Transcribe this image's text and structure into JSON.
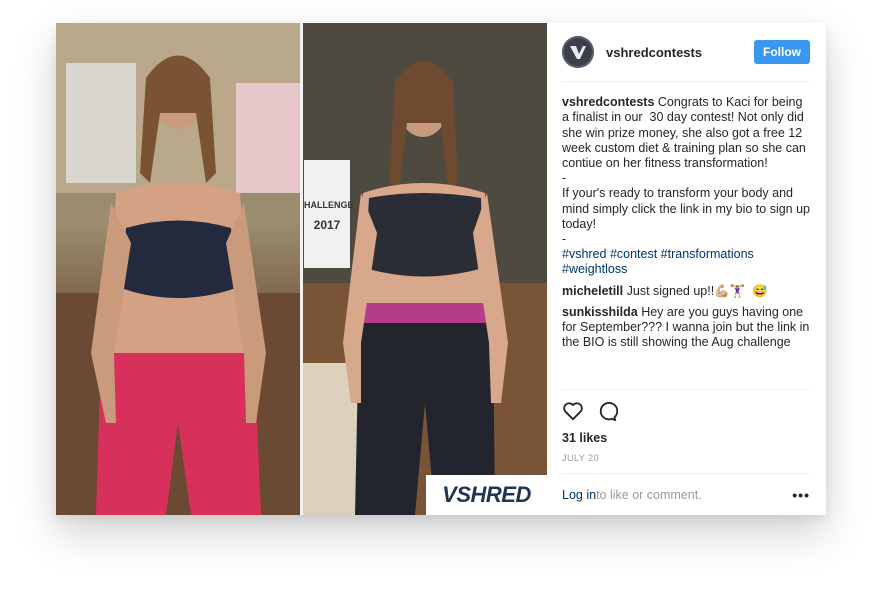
{
  "post": {
    "username": "vshredcontests",
    "follow_label": "Follow",
    "comments": [
      {
        "user": "vshredcontests",
        "text": " Congrats to Kaci for being a finalist in our  30 day contest! Not only did she win prize money, she also got a free 12 week custom diet & training plan so she can contiue on her fitness transformation!\n-\nIf your's ready to transform your body and mind simply click the link in my bio to sign up today!\n-\n",
        "tags": "#vshred #contest #transformations #weightloss"
      },
      {
        "user": "micheletill",
        "text": " Just signed up!!💪🏼🏋‍♀️  😅"
      },
      {
        "user": "sunkisshilda",
        "text": " Hey are you guys having one for September??? I wanna join but the link in the BIO is still showing the Aug challenge"
      }
    ],
    "likes": "31 likes",
    "date": "JULY 20",
    "login_link": "Log in",
    "login_suffix": " to like or comment.",
    "more_label": "•••"
  },
  "photo": {
    "logo": "VSHRED",
    "sign_text": "HALLENGE",
    "sign_year": "2017"
  },
  "icons": [
    "heart-icon",
    "comment-icon",
    "more-options-icon"
  ]
}
